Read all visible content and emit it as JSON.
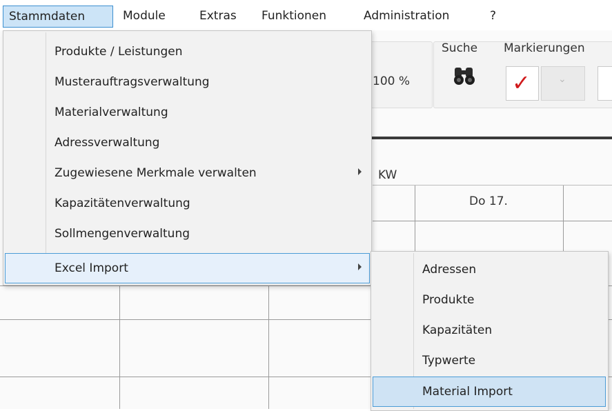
{
  "menubar": {
    "items": [
      "Stammdaten",
      "Module",
      "Extras",
      "Funktionen",
      "Administration",
      "?"
    ]
  },
  "toolbar": {
    "zoom": "100 %",
    "search_label": "Suche",
    "markings_label": "Markierungen",
    "calendar_week_label": "KW",
    "day_header": "Do 17."
  },
  "stammdaten_menu": {
    "items": [
      {
        "label": "Produkte / Leistungen",
        "submenu": false
      },
      {
        "label": "Musterauftragsverwaltung",
        "submenu": false
      },
      {
        "label": "Materialverwaltung",
        "submenu": false
      },
      {
        "label": "Adressverwaltung",
        "submenu": false
      },
      {
        "label": "Zugewiesene Merkmale verwalten",
        "submenu": true
      },
      {
        "label": "Kapazitätenverwaltung",
        "submenu": false
      },
      {
        "label": "Sollmengenverwaltung",
        "submenu": false
      },
      {
        "label": "Excel Import",
        "submenu": true
      }
    ]
  },
  "excel_import_submenu": {
    "items": [
      "Adressen",
      "Produkte",
      "Kapazitäten",
      "Typwerte",
      "Material Import"
    ]
  }
}
